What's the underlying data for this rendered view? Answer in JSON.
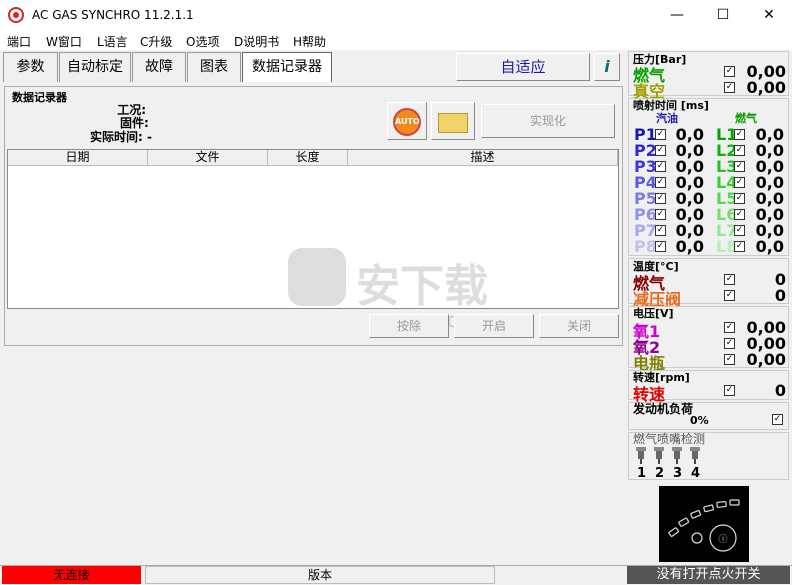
{
  "window": {
    "title": "AC GAS SYNCHRO  11.2.1.1",
    "minimize": "—",
    "maximize": "☐",
    "close": "✕"
  },
  "menu": [
    "端口",
    "W窗口",
    "L语言",
    "C升级",
    "O选项",
    "D说明书",
    "H帮助"
  ],
  "tabs": [
    "参数",
    "自动标定",
    "故障",
    "图表",
    "数据记录器"
  ],
  "adaptive_button": "自适应",
  "info_icon": "i",
  "recorder": {
    "title": "数据记录器",
    "labels": [
      "工况:",
      "固件: -",
      "实际时间: -"
    ],
    "auto_label": "AUTO",
    "realize_button": "实现化",
    "columns": [
      "日期",
      "文件",
      "长度",
      "描述"
    ],
    "buttons": {
      "delete": "按除",
      "start": "开启",
      "close": "关闭"
    }
  },
  "pressure": {
    "title": "压力[Bar]",
    "rows": [
      {
        "name": "燃气",
        "value": "0,00"
      },
      {
        "name": "真空",
        "value": "0,00"
      }
    ]
  },
  "injection": {
    "title": "喷射时间 [ms]",
    "petrol_label": "汽油",
    "gas_label": "燃气",
    "petrol": [
      {
        "name": "P1",
        "value": "0,0"
      },
      {
        "name": "P2",
        "value": "0,0"
      },
      {
        "name": "P3",
        "value": "0,0"
      },
      {
        "name": "P4",
        "value": "0,0"
      },
      {
        "name": "P5",
        "value": "0,0"
      },
      {
        "name": "P6",
        "value": "0,0"
      },
      {
        "name": "P7",
        "value": "0,0"
      },
      {
        "name": "P8",
        "value": "0,0"
      }
    ],
    "gas": [
      {
        "name": "L1",
        "value": "0,0"
      },
      {
        "name": "L2",
        "value": "0,0"
      },
      {
        "name": "L3",
        "value": "0,0"
      },
      {
        "name": "L4",
        "value": "0,0"
      },
      {
        "name": "L5",
        "value": "0,0"
      },
      {
        "name": "L6",
        "value": "0,0"
      },
      {
        "name": "L7",
        "value": "0,0"
      },
      {
        "name": "L8",
        "value": "0,0"
      }
    ]
  },
  "temperature": {
    "title": "温度[°C]",
    "rows": [
      {
        "name": "燃气",
        "value": "0"
      },
      {
        "name": "减压阀",
        "value": "0"
      }
    ]
  },
  "voltage": {
    "title": "电压[V]",
    "rows": [
      {
        "name": "氧1",
        "value": "0,00"
      },
      {
        "name": "氧2",
        "value": "0,00"
      },
      {
        "name": "电瓶",
        "value": "0,00"
      }
    ]
  },
  "rpm": {
    "title": "转速[rpm]",
    "rows": [
      {
        "name": "转速",
        "value": "0"
      }
    ]
  },
  "load": {
    "title": "发动机负荷",
    "value": "0%"
  },
  "nozzle": {
    "title": "燃气喷嘴检测",
    "labels": [
      "1",
      "2",
      "3",
      "4"
    ]
  },
  "ignition_status": "没有打开点火开关",
  "status": {
    "connection": "无连接",
    "version": "版本"
  },
  "watermark": {
    "text": "安下载",
    "sub": "anxz.com"
  },
  "colors": {
    "connection_bg": "#ff0000",
    "gauge_bg": "#000000"
  }
}
